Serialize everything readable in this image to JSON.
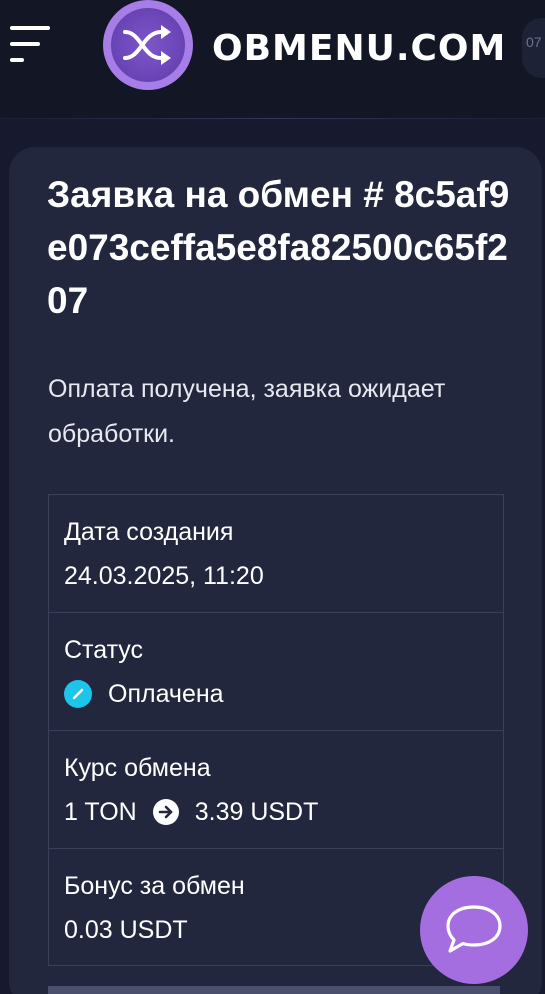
{
  "header": {
    "menu_icon": "hamburger-menu-icon",
    "logo_icon": "exchange-arrows-icon",
    "logo_text": "OBMENU.COM",
    "clipped_text": "07",
    "colors": {
      "logo_ring": "#a77de8",
      "logo_fill": "#7d56c8"
    }
  },
  "order": {
    "title": "Заявка на обмен # 8c5af9e073ceffa5e8fa82500c65f207",
    "subtitle": "Оплата получена, заявка ожидает обработки."
  },
  "details": {
    "created": {
      "label": "Дата создания",
      "value": "24.03.2025, 11:20"
    },
    "status": {
      "label": "Статус",
      "value": "Оплачена",
      "icon": "slash-circle-icon",
      "color": "#1dc4ec"
    },
    "rate": {
      "label": "Курс обмена",
      "from": "1 TON",
      "to": "3.39 USDT",
      "icon": "arrow-right-circle-icon"
    },
    "bonus": {
      "label": "Бонус за обмен",
      "value": "0.03 USDT"
    }
  },
  "chat": {
    "icon": "chat-bubble-icon",
    "color": "#a56ee0"
  }
}
